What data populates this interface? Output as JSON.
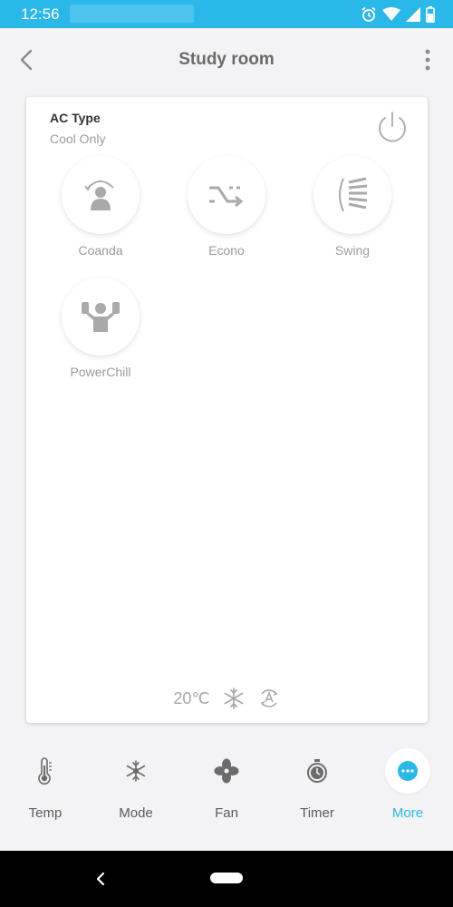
{
  "status_bar": {
    "time": "12:56"
  },
  "app_bar": {
    "title": "Study room"
  },
  "card": {
    "ac_type_label": "AC Type",
    "ac_type_value": "Cool Only",
    "features": [
      {
        "label": "Coanda",
        "icon": "coanda-icon"
      },
      {
        "label": "Econo",
        "icon": "econo-icon"
      },
      {
        "label": "Swing",
        "icon": "swing-icon"
      },
      {
        "label": "PowerChill",
        "icon": "powerchill-icon"
      }
    ],
    "status": {
      "temperature": "20℃",
      "mode_icon": "snowflake-icon",
      "fan_icon": "auto-fan-icon"
    }
  },
  "bottom_nav": {
    "items": [
      {
        "label": "Temp",
        "icon": "thermometer-icon"
      },
      {
        "label": "Mode",
        "icon": "mode-icon"
      },
      {
        "label": "Fan",
        "icon": "fan-icon"
      },
      {
        "label": "Timer",
        "icon": "timer-icon"
      },
      {
        "label": "More",
        "icon": "more-icon",
        "active": true
      }
    ]
  },
  "colors": {
    "accent": "#2ab8e9",
    "icon_gray": "#a9a9a9",
    "background": "#f3f3f5"
  }
}
